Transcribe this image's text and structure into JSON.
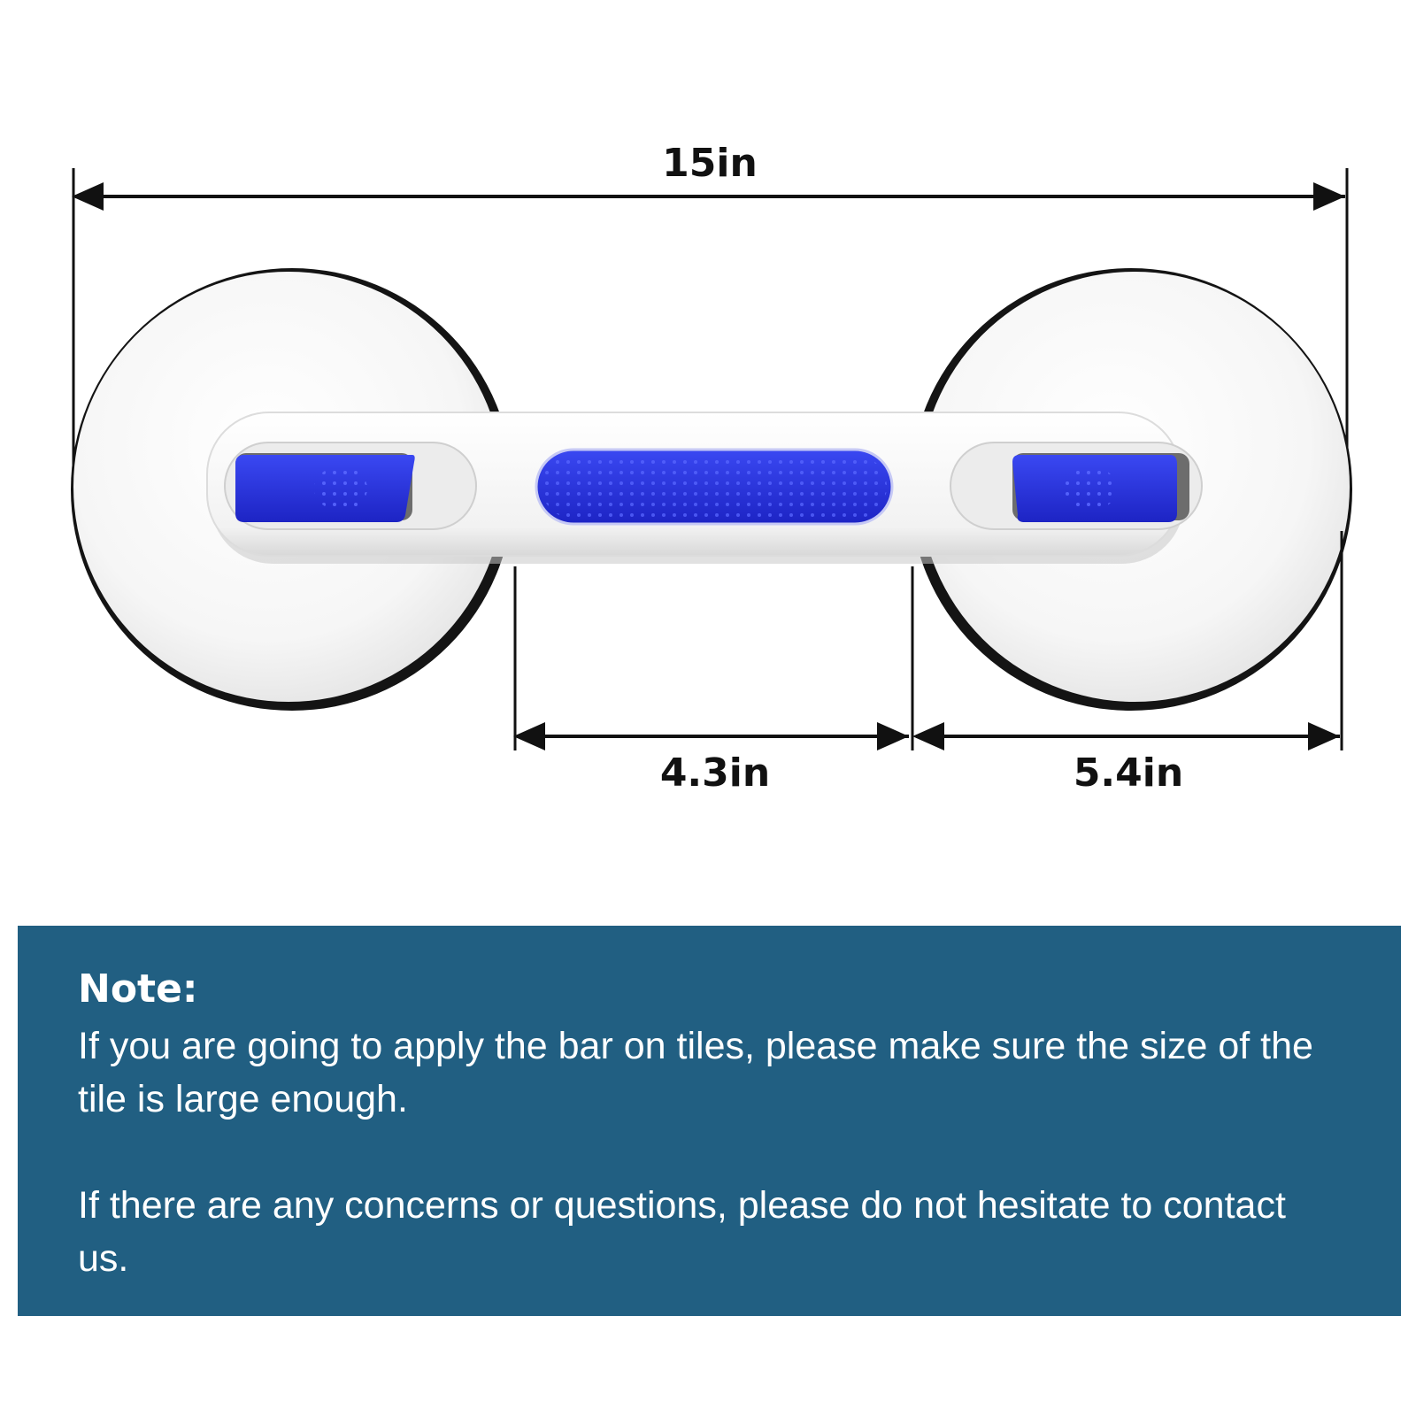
{
  "colors": {
    "panel_background": "#215f82",
    "grip_blue": "#2a35e0",
    "suction_rim": "#141414",
    "dimension_line": "#111111"
  },
  "dimensions": {
    "overall_length": "15in",
    "gap_between_cups": "4.3in",
    "cup_diameter": "5.4in"
  },
  "product": {
    "name_icon": "suction-grab-bar"
  },
  "note": {
    "title": "Note:",
    "paragraph_1": "If you are going to apply the bar on tiles, please make sure the size of the tile is large enough.",
    "paragraph_2": "If there are any concerns or questions, please do not hesitate to contact us."
  }
}
